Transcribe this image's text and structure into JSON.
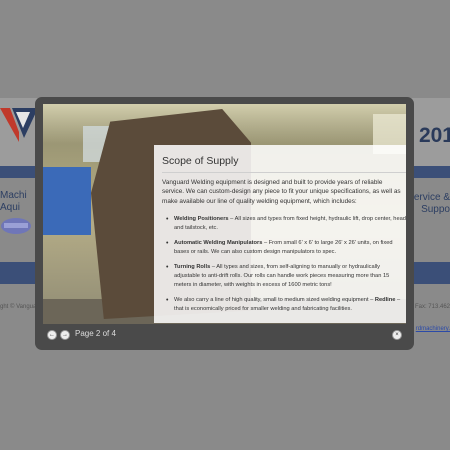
{
  "background_site": {
    "year": "201",
    "nav_left": [
      "Machi",
      "Aqui"
    ],
    "nav_right": [
      "Service &",
      "Suppo"
    ],
    "copyright": "ght © Vanguar",
    "fax": "Fax: 713.462",
    "email": "rdmachinery.",
    "colors": {
      "band": "#3b4f78",
      "logo_red": "#c0392b",
      "logo_blue": "#2c3e62"
    }
  },
  "lightbox": {
    "slide_title": "Scope of Supply",
    "intro": "Vanguard Welding equipment is designed and built to provide years of reliable service. We can custom-design any piece to fit your unique specifications, as well as make available our line of quality welding equipment, which includes:",
    "items": [
      {
        "title": "Welding Positioners",
        "text": " – All sizes and types from fixed height, hydraulic lift, drop center, head and tailstock, etc."
      },
      {
        "title": "Automatic Welding Manipulators",
        "text": " – From small 6' x 6' to large 26' x 26' units, on fixed bases or rails. We can also custom design manipulators to spec."
      },
      {
        "title": "Turning Rolls",
        "text": " – All types and sizes, from self-aligning to manually or hydraulically adjustable to anti-drift rolls. Our rolls can handle work pieces measuring more than 15 meters in diameter, with weights in excess of 1600 metric tons!"
      },
      {
        "prefix": "We also carry a line of high quality, small to medium sized welding equipment – ",
        "title": "Redline",
        "text": " – that is economically priced for smaller welding and fabricating facilities."
      }
    ],
    "page_indicator": "Page 2 of 4",
    "prev_icon": "←",
    "next_icon": "→",
    "close_icon": "×"
  }
}
